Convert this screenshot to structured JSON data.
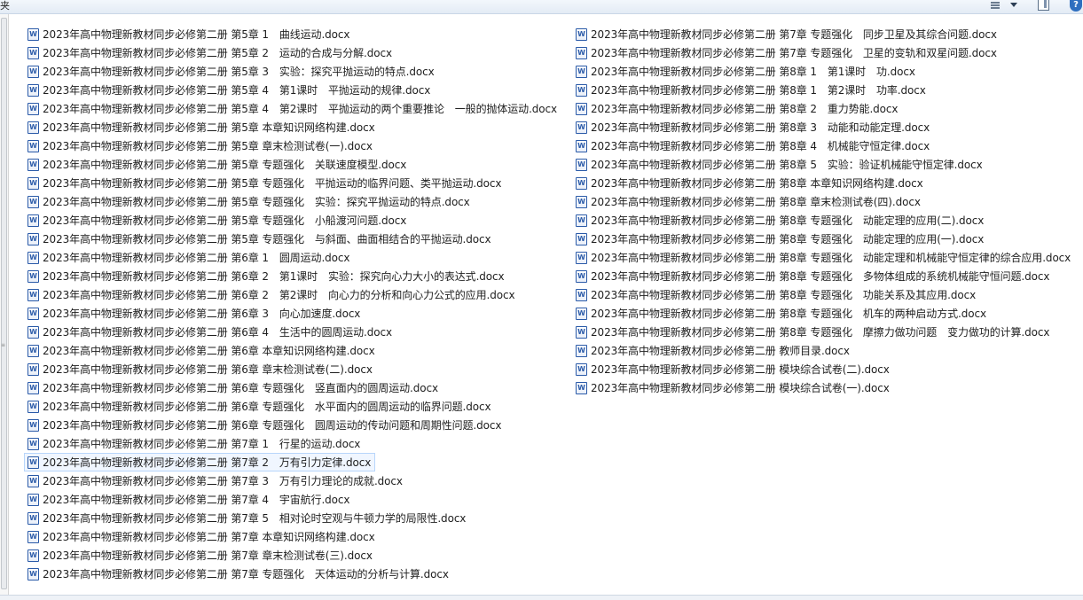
{
  "toolbar": {
    "title": "夹",
    "view_icon": "view-options-icon",
    "view_dropdown_icon": "dropdown-arrow-icon",
    "preview_icon": "preview-pane-icon",
    "help_label": "?"
  },
  "left_column": [
    "2023年高中物理新教材同步必修第二册 第5章 1　曲线运动.docx",
    "2023年高中物理新教材同步必修第二册 第5章 2　运动的合成与分解.docx",
    "2023年高中物理新教材同步必修第二册 第5章 3　实验：探究平抛运动的特点.docx",
    "2023年高中物理新教材同步必修第二册 第5章 4　第1课时　平抛运动的规律.docx",
    "2023年高中物理新教材同步必修第二册 第5章 4　第2课时　平抛运动的两个重要推论　一般的抛体运动.docx",
    "2023年高中物理新教材同步必修第二册 第5章 本章知识网络构建.docx",
    "2023年高中物理新教材同步必修第二册 第5章 章末检测试卷(一).docx",
    "2023年高中物理新教材同步必修第二册 第5章 专题强化　关联速度模型.docx",
    "2023年高中物理新教材同步必修第二册 第5章 专题强化　平抛运动的临界问题、类平抛运动.docx",
    "2023年高中物理新教材同步必修第二册 第5章 专题强化　实验：探究平抛运动的特点.docx",
    "2023年高中物理新教材同步必修第二册 第5章 专题强化　小船渡河问题.docx",
    "2023年高中物理新教材同步必修第二册 第5章 专题强化　与斜面、曲面相结合的平抛运动.docx",
    "2023年高中物理新教材同步必修第二册 第6章 1　圆周运动.docx",
    "2023年高中物理新教材同步必修第二册 第6章 2　第1课时　实验：探究向心力大小的表达式.docx",
    "2023年高中物理新教材同步必修第二册 第6章 2　第2课时　向心力的分析和向心力公式的应用.docx",
    "2023年高中物理新教材同步必修第二册 第6章 3　向心加速度.docx",
    "2023年高中物理新教材同步必修第二册 第6章 4　生活中的圆周运动.docx",
    "2023年高中物理新教材同步必修第二册 第6章 本章知识网络构建.docx",
    "2023年高中物理新教材同步必修第二册 第6章 章末检测试卷(二).docx",
    "2023年高中物理新教材同步必修第二册 第6章 专题强化　竖直面内的圆周运动.docx",
    "2023年高中物理新教材同步必修第二册 第6章 专题强化　水平面内的圆周运动的临界问题.docx",
    "2023年高中物理新教材同步必修第二册 第6章 专题强化　圆周运动的传动问题和周期性问题.docx",
    "2023年高中物理新教材同步必修第二册 第7章 1　行星的运动.docx",
    "2023年高中物理新教材同步必修第二册 第7章 2　万有引力定律.docx",
    "2023年高中物理新教材同步必修第二册 第7章 3　万有引力理论的成就.docx",
    "2023年高中物理新教材同步必修第二册 第7章 4　宇宙航行.docx",
    "2023年高中物理新教材同步必修第二册 第7章 5　相对论时空观与牛顿力学的局限性.docx",
    "2023年高中物理新教材同步必修第二册 第7章 本章知识网络构建.docx",
    "2023年高中物理新教材同步必修第二册 第7章 章末检测试卷(三).docx",
    "2023年高中物理新教材同步必修第二册 第7章 专题强化　天体运动的分析与计算.docx"
  ],
  "right_column": [
    "2023年高中物理新教材同步必修第二册 第7章 专题强化　同步卫星及其综合问题.docx",
    "2023年高中物理新教材同步必修第二册 第7章 专题强化　卫星的变轨和双星问题.docx",
    "2023年高中物理新教材同步必修第二册 第8章 1　第1课时　功.docx",
    "2023年高中物理新教材同步必修第二册 第8章 1　第2课时　功率.docx",
    "2023年高中物理新教材同步必修第二册 第8章 2　重力势能.docx",
    "2023年高中物理新教材同步必修第二册 第8章 3　动能和动能定理.docx",
    "2023年高中物理新教材同步必修第二册 第8章 4　机械能守恒定律.docx",
    "2023年高中物理新教材同步必修第二册 第8章 5　实验：验证机械能守恒定律.docx",
    "2023年高中物理新教材同步必修第二册 第8章 本章知识网络构建.docx",
    "2023年高中物理新教材同步必修第二册 第8章 章末检测试卷(四).docx",
    "2023年高中物理新教材同步必修第二册 第8章 专题强化　动能定理的应用(二).docx",
    "2023年高中物理新教材同步必修第二册 第8章 专题强化　动能定理的应用(一).docx",
    "2023年高中物理新教材同步必修第二册 第8章 专题强化　动能定理和机械能守恒定律的综合应用.docx",
    "2023年高中物理新教材同步必修第二册 第8章 专题强化　多物体组成的系统机械能守恒问题.docx",
    "2023年高中物理新教材同步必修第二册 第8章 专题强化　功能关系及其应用.docx",
    "2023年高中物理新教材同步必修第二册 第8章 专题强化　机车的两种启动方式.docx",
    "2023年高中物理新教材同步必修第二册 第8章 专题强化　摩擦力做功问题　变力做功的计算.docx",
    "2023年高中物理新教材同步必修第二册 教师目录.docx",
    "2023年高中物理新教材同步必修第二册 模块综合试卷(二).docx",
    "2023年高中物理新教材同步必修第二册 模块综合试卷(一).docx"
  ],
  "file_icon": "word-document-icon",
  "hovered_item": "2023年高中物理新教材同步必修第二册 第7章 2　万有引力定律.docx"
}
